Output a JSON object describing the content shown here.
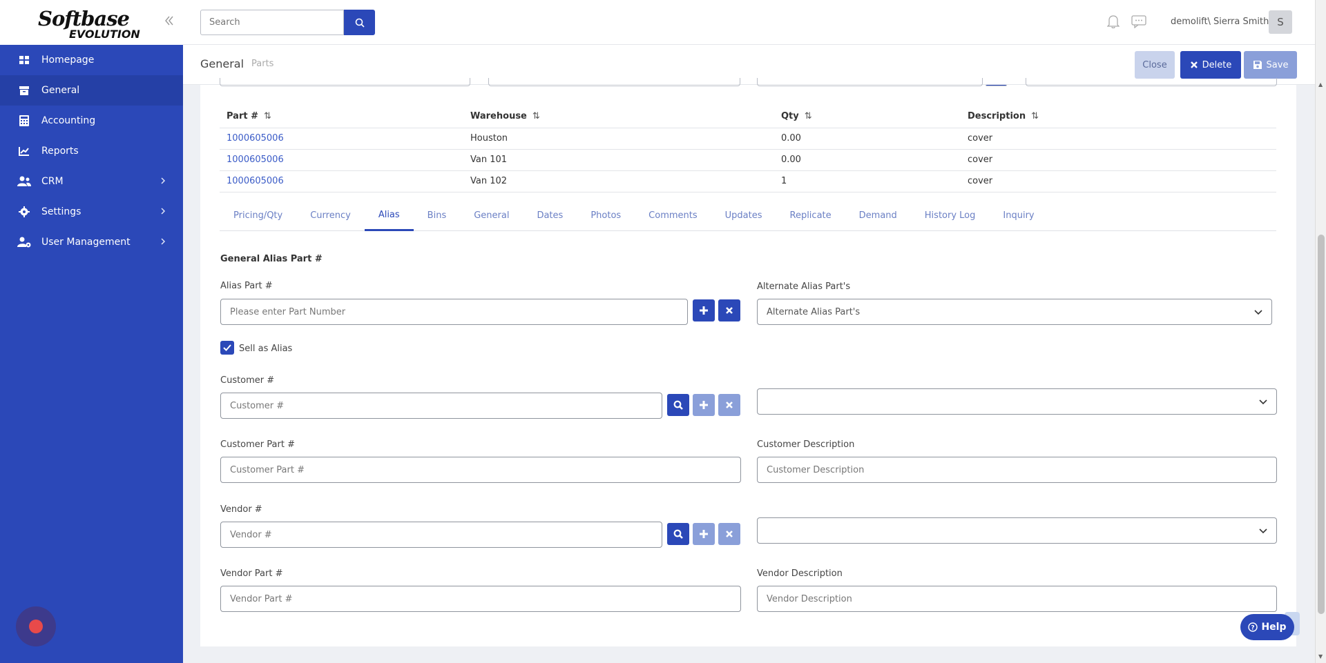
{
  "brand": {
    "logo_top": "Softbase",
    "logo_bottom": "EVOLUTION"
  },
  "sidebar": {
    "items": [
      {
        "label": "Homepage",
        "icon": "home-icon"
      },
      {
        "label": "General",
        "icon": "archive-icon",
        "active": true
      },
      {
        "label": "Accounting",
        "icon": "calculator-icon"
      },
      {
        "label": "Reports",
        "icon": "chart-icon"
      },
      {
        "label": "CRM",
        "icon": "users-icon",
        "has_submenu": true
      },
      {
        "label": "Settings",
        "icon": "gear-icon",
        "has_submenu": true
      },
      {
        "label": "User Management",
        "icon": "user-gear-icon",
        "has_submenu": true
      }
    ]
  },
  "topbar": {
    "search_placeholder": "Search",
    "user": "demolift\\ Sierra Smith",
    "avatar_initial": "S"
  },
  "header": {
    "title": "General",
    "subtitle": "Parts",
    "close_label": "Close",
    "delete_label": "Delete",
    "save_label": "Save"
  },
  "parts_table": {
    "columns": [
      "Part #",
      "Warehouse",
      "Qty",
      "Description"
    ],
    "rows": [
      [
        "1000605006",
        "Houston",
        "0.00",
        "cover"
      ],
      [
        "1000605006",
        "Van 101",
        "0.00",
        "cover"
      ],
      [
        "1000605006",
        "Van 102",
        "1",
        "cover"
      ]
    ]
  },
  "tabs": [
    "Pricing/Qty",
    "Currency",
    "Alias",
    "Bins",
    "General",
    "Dates",
    "Photos",
    "Comments",
    "Updates",
    "Replicate",
    "Demand",
    "History Log",
    "Inquiry"
  ],
  "active_tab": "Alias",
  "form": {
    "section_title": "General Alias Part #",
    "alias_label": "Alias Part #",
    "alias_placeholder": "Please enter Part Number",
    "alternate_label": "Alternate Alias Part's",
    "alternate_value": "Alternate Alias Part's",
    "sell_as_alias_label": "Sell as Alias",
    "sell_as_alias_checked": true,
    "customer_label": "Customer #",
    "customer_placeholder": "Customer #",
    "customer_part_label": "Customer Part #",
    "customer_part_placeholder": "Customer Part #",
    "customer_desc_label": "Customer Description",
    "customer_desc_placeholder": "Customer Description",
    "vendor_label": "Vendor #",
    "vendor_placeholder": "Vendor #",
    "vendor_part_label": "Vendor Part #",
    "vendor_part_placeholder": "Vendor Part #",
    "vendor_desc_label": "Vendor Description",
    "vendor_desc_placeholder": "Vendor Description"
  },
  "help_label": "Help",
  "colors": {
    "primary": "#2b48b8",
    "primary_light": "#8a9fd9",
    "link": "#3a5bc7"
  }
}
